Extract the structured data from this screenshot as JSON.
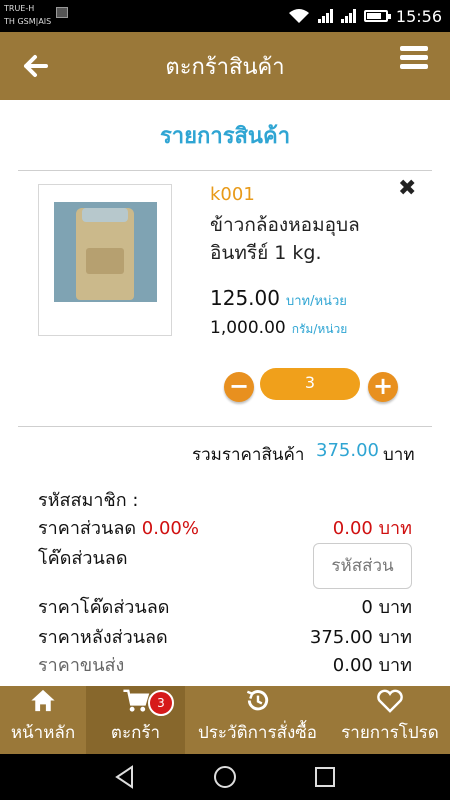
{
  "status_bar": {
    "carrier_line1": "TRUE-H",
    "carrier_line2": "TH GSM|AIS",
    "time": "15:56"
  },
  "header": {
    "title": "ตะกร้าสินค้า"
  },
  "section": {
    "title": "รายการสินค้า"
  },
  "product": {
    "code": "k001",
    "name_line1": "ข้าวกล้องหอมอุบล",
    "name_line2": "อินทรีย์ 1 kg.",
    "price": "125.00",
    "price_unit": "บาท/หน่วย",
    "weight": "1,000.00",
    "weight_unit": "กรัม/หน่วย",
    "quantity": "3"
  },
  "summary": {
    "total_label": "รวมราคาสินค้า",
    "total_value": "375.00",
    "currency": "บาท",
    "member_code_label": "รหัสสมาชิก :",
    "discount_label": "ราคาส่วนลด",
    "discount_percent": "0.00%",
    "discount_value": "0.00 บาท",
    "coupon_label": "โค๊ดส่วนลด",
    "coupon_placeholder": "รหัสส่วน",
    "coupon_discount_label": "ราคาโค๊ดส่วนลด",
    "coupon_discount_value": "0 บาท",
    "after_discount_label": "ราคาหลังส่วนลด",
    "after_discount_value": "375.00 บาท",
    "shipping_label": "ราคาขนส่ง",
    "shipping_value": "0.00 บาท"
  },
  "bottom_nav": {
    "items": [
      {
        "label": "หน้าหลัก",
        "icon": "home-icon"
      },
      {
        "label": "ตะกร้า",
        "icon": "cart-icon",
        "badge": "3"
      },
      {
        "label": "ประวัติการสั่งซื้อ",
        "icon": "history-icon"
      },
      {
        "label": "รายการโปรด",
        "icon": "heart-icon"
      }
    ]
  },
  "colors": {
    "primary": "#9a7839",
    "accent_blue": "#2fa5d3",
    "accent_orange": "#f0a01b",
    "red": "#d01010"
  }
}
